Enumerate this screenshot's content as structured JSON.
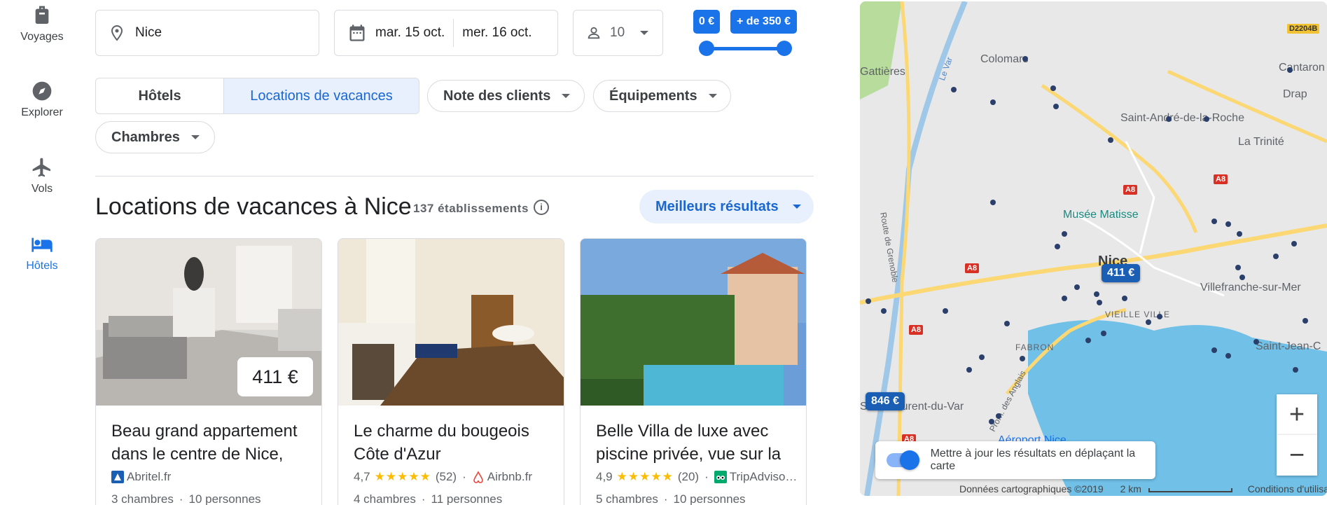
{
  "nav": {
    "items": [
      {
        "label": "Voyages",
        "icon": "luggage-icon"
      },
      {
        "label": "Explorer",
        "icon": "compass-icon"
      },
      {
        "label": "Vols",
        "icon": "airplane-icon"
      },
      {
        "label": "Hôtels",
        "icon": "bed-icon",
        "active": true
      }
    ]
  },
  "search": {
    "location": "Nice",
    "checkin": "mar. 15 oct.",
    "checkout": "mer. 16 oct.",
    "guests": "10"
  },
  "price_filter": {
    "min_label": "0 €",
    "max_label": "+ de 350 €"
  },
  "filters": {
    "hotels": "Hôtels",
    "rentals": "Locations de vacances",
    "rating": "Note des clients",
    "amenities": "Équipements",
    "rooms": "Chambres"
  },
  "results": {
    "title": "Locations de vacances à Nice",
    "count": "137 établissements",
    "sort": "Meilleurs résultats"
  },
  "cards": [
    {
      "name": "Beau grand appartement dans le centre de Nice,",
      "price": "411 €",
      "rating": "",
      "reviews": "",
      "source": "Abritel.fr",
      "rooms": "3 chambres",
      "people": "10 personnes"
    },
    {
      "name": "Le charme du bougeois Côte d'Azur",
      "price": "",
      "rating": "4,7",
      "reviews": "(52)",
      "source": "Airbnb.fr",
      "rooms": "4 chambres",
      "people": "11 personnes"
    },
    {
      "name": "Belle Villa de luxe avec piscine privée, vue sur la",
      "price": "",
      "rating": "4,9",
      "reviews": "(20)",
      "source": "TripAdviso…",
      "rooms": "5 chambres",
      "people": "10 personnes"
    }
  ],
  "stars": "★★★★★",
  "map": {
    "labels": {
      "gattieres": "Gattières",
      "colomars": "Colomars",
      "cantaron": "Cantaron",
      "drap": "Drap",
      "saint_andre": "Saint-André-de-la-Roche",
      "trinite": "La Trinité",
      "matisse": "Musée Matisse",
      "nice": "Nice",
      "villefranche": "Villefranche-sur-Mer",
      "vieille_ville": "VIEILLE VILLE",
      "fabron": "FABRON",
      "saint_jean": "Saint-Jean-C",
      "saint_laurent": "Saint-Laurent-du-Var",
      "aeroport": "Aéroport Nice",
      "route_grenoble": "Route de Grenoble",
      "le_var": "Le Var",
      "prom": "Prom. des Anglais",
      "d2204b": "D2204B",
      "a8": "A8"
    },
    "price_markers": [
      "411 €",
      "846 €"
    ],
    "toggle_label": "Mettre à jour les résultats en déplaçant la carte",
    "attribution": "Données cartographiques ©2019",
    "scale": "2 km",
    "terms": "Conditions d'utilisation",
    "zoom_in": "+",
    "zoom_out": "−"
  }
}
